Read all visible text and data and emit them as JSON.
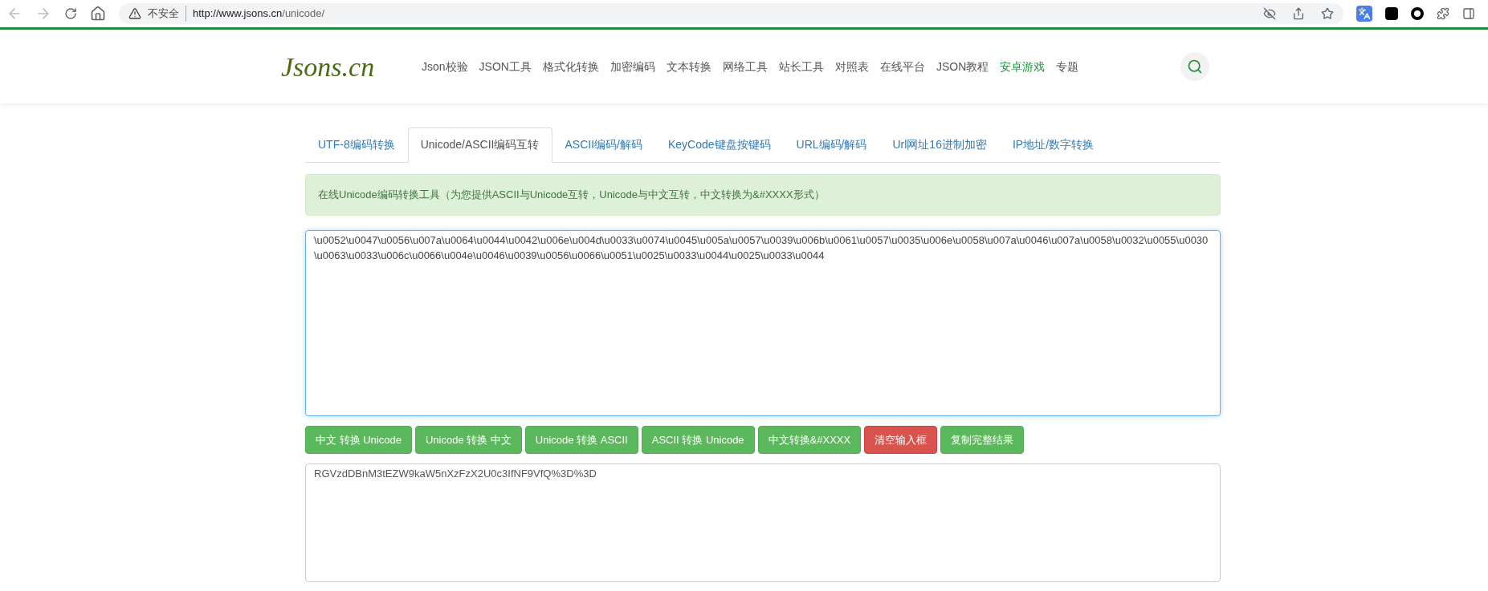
{
  "browser": {
    "security": "不安全",
    "url_host": "http://www.jsons.cn",
    "url_path": "/unicode/"
  },
  "header": {
    "logo": "Jsons.cn",
    "nav": [
      {
        "label": "Json校验",
        "selected": false
      },
      {
        "label": "JSON工具",
        "selected": false
      },
      {
        "label": "格式化转换",
        "selected": false
      },
      {
        "label": "加密编码",
        "selected": false
      },
      {
        "label": "文本转换",
        "selected": false
      },
      {
        "label": "网络工具",
        "selected": false
      },
      {
        "label": "站长工具",
        "selected": false
      },
      {
        "label": "对照表",
        "selected": false
      },
      {
        "label": "在线平台",
        "selected": false
      },
      {
        "label": "JSON教程",
        "selected": false
      },
      {
        "label": "安卓游戏",
        "selected": true
      },
      {
        "label": "专题",
        "selected": false
      }
    ]
  },
  "tabs": [
    {
      "label": "UTF-8编码转换",
      "selected": false
    },
    {
      "label": "Unicode/ASCII编码互转",
      "selected": true
    },
    {
      "label": "ASCII编码/解码",
      "selected": false
    },
    {
      "label": "KeyCode键盘按键码",
      "selected": false
    },
    {
      "label": "URL编码/解码",
      "selected": false
    },
    {
      "label": "Url网址16进制加密",
      "selected": false
    },
    {
      "label": "IP地址/数字转换",
      "selected": false
    }
  ],
  "info": "在线Unicode编码转换工具（为您提供ASCII与Unicode互转，Unicode与中文互转，中文转换为&#XXXX形式）",
  "input": {
    "value": "\\u0052\\u0047\\u0056\\u007a\\u0064\\u0044\\u0042\\u006e\\u004d\\u0033\\u0074\\u0045\\u005a\\u0057\\u0039\\u006b\\u0061\\u0057\\u0035\\u006e\\u0058\\u007a\\u0046\\u007a\\u0058\\u0032\\u0055\\u0030\\u0063\\u0033\\u006c\\u0066\\u004e\\u0046\\u0039\\u0056\\u0066\\u0051\\u0025\\u0033\\u0044\\u0025\\u0033\\u0044"
  },
  "buttons": [
    {
      "label": "中文 转换 Unicode",
      "kind": "primary"
    },
    {
      "label": "Unicode 转换 中文",
      "kind": "primary"
    },
    {
      "label": "Unicode 转换 ASCII",
      "kind": "primary"
    },
    {
      "label": "ASCII 转换 Unicode",
      "kind": "primary"
    },
    {
      "label": "中文转换&#XXXX",
      "kind": "primary"
    },
    {
      "label": "清空输入框",
      "kind": "danger"
    },
    {
      "label": "复制完整结果",
      "kind": "primary"
    }
  ],
  "output": {
    "value": "RGVzdDBnM3tEZW9kaW5nXzFzX2U0c3IfNF9VfQ%3D%3D"
  }
}
